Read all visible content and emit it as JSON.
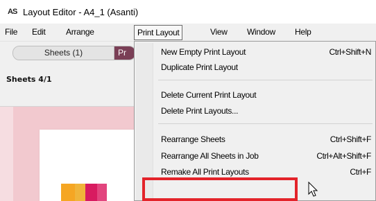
{
  "window": {
    "icon_text": "AS",
    "title": "Layout Editor - A4_1 (Asanti)"
  },
  "menubar": {
    "items": [
      {
        "label": "File"
      },
      {
        "label": "Edit"
      },
      {
        "label": "Arrange"
      },
      {
        "label": "Print Layout"
      },
      {
        "label": "View"
      },
      {
        "label": "Window"
      },
      {
        "label": "Help"
      }
    ]
  },
  "left_panel": {
    "tabs": [
      {
        "label": "Sheets (1)"
      },
      {
        "label": "Pr"
      }
    ],
    "sheets_label": "Sheets 4/1"
  },
  "print_layout_menu": {
    "items": [
      {
        "label": "New Empty Print Layout",
        "shortcut": "Ctrl+Shift+N"
      },
      {
        "label": "Duplicate Print Layout",
        "shortcut": ""
      },
      {
        "label": "Delete Current Print Layout",
        "shortcut": ""
      },
      {
        "label": "Delete Print Layouts...",
        "shortcut": ""
      },
      {
        "label": "Rearrange Sheets",
        "shortcut": "Ctrl+Shift+F"
      },
      {
        "label": "Rearrange All Sheets in Job",
        "shortcut": "Ctrl+Alt+Shift+F"
      },
      {
        "label": "Remake All Print Layouts",
        "shortcut": "Ctrl+F"
      }
    ]
  },
  "colors": {
    "highlight": "#e3232a",
    "active_tab": "#7a3f56",
    "canvas_bg": "#f2c9cf",
    "thumb_orange": "#f5a623",
    "thumb_pink": "#d81b60"
  }
}
